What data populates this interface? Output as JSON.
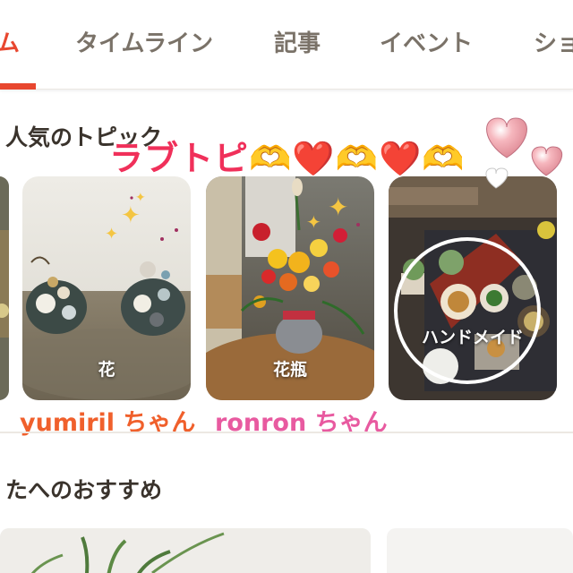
{
  "tabs": [
    {
      "label": "ム",
      "active": true
    },
    {
      "label": "タイムライン",
      "active": false
    },
    {
      "label": "記事",
      "active": false
    },
    {
      "label": "イベント",
      "active": false
    },
    {
      "label": "ショ",
      "active": false
    }
  ],
  "popular": {
    "title": "人気のトピック",
    "cards": [
      {
        "label": ""
      },
      {
        "label": "花"
      },
      {
        "label": "花瓶"
      },
      {
        "label": "ハンドメイド"
      }
    ]
  },
  "overlay": {
    "title": "ラブトピ🫶❤️🫶❤️🫶",
    "captions": [
      {
        "text": "yumiril ちゃん",
        "color": "#f0602c"
      },
      {
        "text": "ronron ちゃん",
        "color": "#e85aa0"
      }
    ]
  },
  "recommend": {
    "title": "たへのおすすめ"
  },
  "colors": {
    "accent": "#e8472f",
    "tab_text": "#7a7268",
    "heading": "#3a332c"
  }
}
